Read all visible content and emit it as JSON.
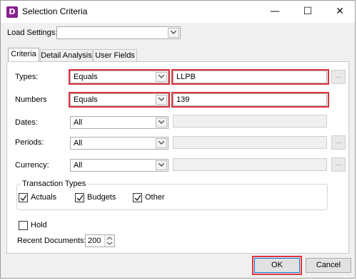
{
  "window": {
    "title": "Selection Criteria",
    "icon_letter": "D",
    "icon_color": "#8a1f8f"
  },
  "titlebar_buttons": {
    "minimize": "—",
    "maximize": "☐",
    "close": "✕"
  },
  "load_settings": {
    "label": "Load Settings:",
    "value": ""
  },
  "tabs": [
    {
      "label": "Criteria",
      "active": true
    },
    {
      "label": "Detail Analysis",
      "active": false
    },
    {
      "label": "User Fields",
      "active": false
    }
  ],
  "criteria": {
    "types": {
      "label": "Types:",
      "operator": "Equals",
      "value": "LLPB"
    },
    "numbers": {
      "label": "Numbers",
      "operator": "Equals",
      "value": "139"
    },
    "dates": {
      "label": "Dates:",
      "operator": "All",
      "value": ""
    },
    "periods": {
      "label": "Periods:",
      "operator": "All",
      "value": ""
    },
    "currency": {
      "label": "Currency:",
      "operator": "All",
      "value": ""
    }
  },
  "transaction_types": {
    "title": "Transaction Types",
    "actuals": {
      "label": "Actuals",
      "checked": true
    },
    "budgets": {
      "label": "Budgets",
      "checked": true
    },
    "other": {
      "label": "Other",
      "checked": true
    }
  },
  "hold": {
    "label": "Hold",
    "checked": false
  },
  "recent_documents": {
    "label": "Recent Documents:",
    "value": "200"
  },
  "buttons": {
    "ok": "OK",
    "cancel": "Cancel",
    "ellipsis": "..."
  },
  "colors": {
    "highlight": "#e0323c",
    "accent": "#0078d7"
  }
}
